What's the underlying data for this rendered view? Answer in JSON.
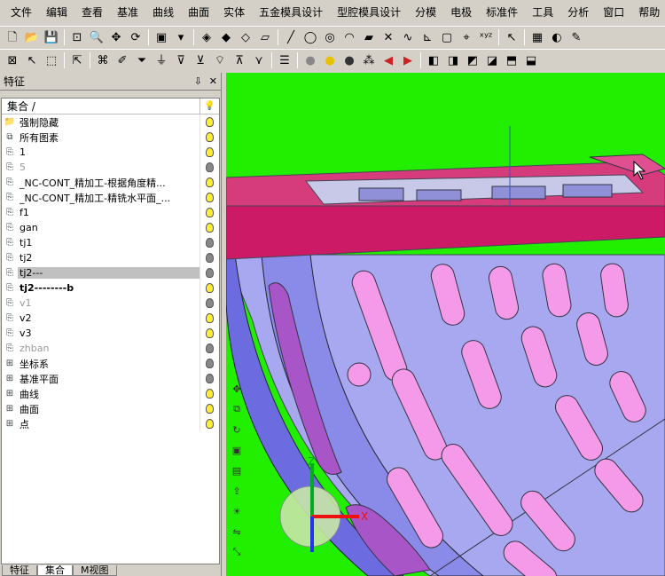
{
  "menu": [
    "文件",
    "编辑",
    "查看",
    "基准",
    "曲线",
    "曲面",
    "实体",
    "五金模具设计",
    "型腔模具设计",
    "分模",
    "电极",
    "标准件",
    "工具",
    "分析",
    "窗口",
    "帮助"
  ],
  "toolbar1": [
    "new-icon",
    "open-icon",
    "save-icon",
    "zoom-fit-icon",
    "zoom-window-icon",
    "zoom-pan-icon",
    "rotate-icon",
    "box-view-icon",
    "dropdown-icon",
    "shade-mode-icon",
    "shade-alt-icon",
    "wireframe-icon",
    "hidden-line-icon",
    "line-icon",
    "circle-icon",
    "point-icon",
    "arc-icon",
    "plane-icon",
    "cross-icon",
    "spline-icon",
    "axis-icon",
    "frame-icon",
    "coord-icon",
    "xyz-icon",
    "cursor-icon",
    "palette-icon",
    "fill-icon",
    "pen-icon"
  ],
  "toolbar2": [
    "filter-icon",
    "select-arrow-icon",
    "select-box-icon",
    "select-extra-icon",
    "feature-icon",
    "edit-feature-icon",
    "filter-a-icon",
    "filter-b-icon",
    "filter-c-icon",
    "filter-d-icon",
    "filter-e-icon",
    "filter-f-icon",
    "filter-g-icon",
    "list-icon",
    "bulb-gray-icon",
    "bulb-on-icon",
    "bulb-off-icon",
    "bulb-group-icon",
    "arrow-left-icon",
    "arrow-right-icon",
    "view-front-icon",
    "view-back-icon",
    "view-left-icon",
    "view-right-icon",
    "view-top-icon",
    "view-iso-icon"
  ],
  "panel": {
    "title": "特征",
    "pin": "⇩",
    "close": "✕",
    "header": "集合 /",
    "rows": [
      {
        "label": "强制隐藏",
        "icon": "folder-icon",
        "bulb": "on",
        "style": ""
      },
      {
        "label": "所有图素",
        "icon": "shapes-icon",
        "bulb": "on",
        "style": ""
      },
      {
        "label": "1",
        "icon": "layer-icon",
        "bulb": "on",
        "style": ""
      },
      {
        "label": "5",
        "icon": "layer-icon",
        "bulb": "off",
        "style": "gray"
      },
      {
        "label": "_NC-CONT_精加工-根据角度精...",
        "icon": "layer-icon",
        "bulb": "on",
        "style": ""
      },
      {
        "label": "_NC-CONT_精加工-精铣水平面_...",
        "icon": "layer-icon",
        "bulb": "on",
        "style": ""
      },
      {
        "label": "f1",
        "icon": "layer-icon",
        "bulb": "on",
        "style": ""
      },
      {
        "label": "gan",
        "icon": "layer-icon",
        "bulb": "on",
        "style": ""
      },
      {
        "label": "tj1",
        "icon": "layer-icon",
        "bulb": "off",
        "style": ""
      },
      {
        "label": "tj2",
        "icon": "layer-icon",
        "bulb": "off",
        "style": ""
      },
      {
        "label": "tj2---",
        "icon": "layer-icon",
        "bulb": "off",
        "style": "sel"
      },
      {
        "label": "tj2--------b",
        "icon": "layer-icon",
        "bulb": "on",
        "style": "bold"
      },
      {
        "label": "v1",
        "icon": "layer-icon",
        "bulb": "off",
        "style": "gray"
      },
      {
        "label": "v2",
        "icon": "layer-icon",
        "bulb": "on",
        "style": ""
      },
      {
        "label": "v3",
        "icon": "layer-icon",
        "bulb": "on",
        "style": ""
      },
      {
        "label": "zhban",
        "icon": "layer-icon",
        "bulb": "off",
        "style": "gray"
      },
      {
        "label": "坐标系",
        "icon": "tree-icon",
        "bulb": "off",
        "style": ""
      },
      {
        "label": "基准平面",
        "icon": "tree-icon",
        "bulb": "off",
        "style": ""
      },
      {
        "label": "曲线",
        "icon": "tree-icon",
        "bulb": "on",
        "style": ""
      },
      {
        "label": "曲面",
        "icon": "tree-icon",
        "bulb": "on",
        "style": ""
      },
      {
        "label": "点",
        "icon": "tree-icon",
        "bulb": "on",
        "style": ""
      }
    ],
    "tabs": [
      "特征",
      "集合",
      "M视图"
    ]
  },
  "viewport": {
    "bg_color": "#22ee00",
    "plate_color": "#cc1a66",
    "body_color": "#a8a8f0",
    "slot_color": "#f59ae8",
    "axis_labels": {
      "x": "X",
      "z": "Z"
    },
    "left_tools": [
      "move-icon",
      "copy-icon",
      "rotate-view-icon",
      "box-icon",
      "save-view-icon",
      "export-icon",
      "light-icon",
      "mirror-icon",
      "scale-icon"
    ]
  }
}
